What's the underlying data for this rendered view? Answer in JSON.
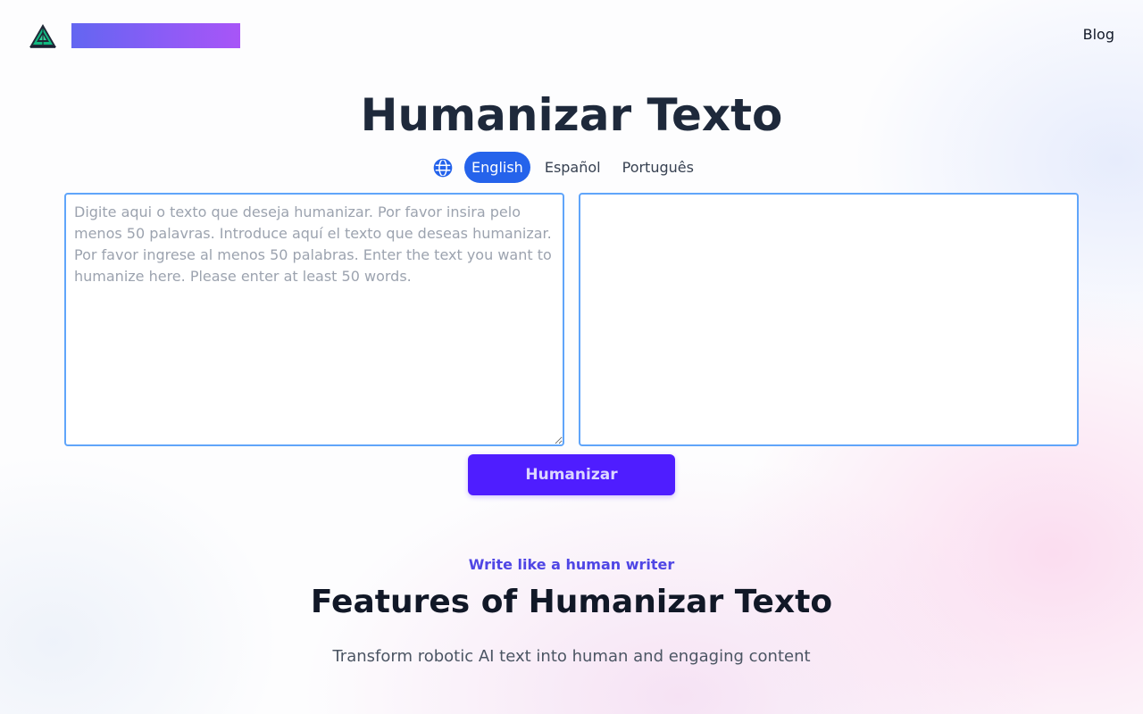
{
  "header": {
    "nav": {
      "blog_label": "Blog"
    }
  },
  "main": {
    "title": "Humanizar Texto",
    "languages": [
      {
        "label": "English",
        "active": true
      },
      {
        "label": "Español",
        "active": false
      },
      {
        "label": "Português",
        "active": false
      }
    ],
    "input": {
      "value": "",
      "placeholder": "Digite aqui o texto que deseja humanizar. Por favor insira pelo menos 50 palavras. Introduce aquí el texto que deseas humanizar. Por favor ingrese al menos 50 palabras. Enter the text you want to humanize here. Please enter at least 50 words."
    },
    "output": {
      "value": ""
    },
    "humanize_label": "Humanizar"
  },
  "features": {
    "tagline": "Write like a human writer",
    "title": "Features of Humanizar Texto",
    "subtitle": "Transform robotic AI text into human and engaging content"
  },
  "colors": {
    "accent": "#2563eb",
    "button": "#4f1dff",
    "tagline": "#4f46e5",
    "editor_border": "#60a5fa"
  },
  "icons": {
    "logo": "pine-tree-logo-icon",
    "language": "globe-icon"
  }
}
